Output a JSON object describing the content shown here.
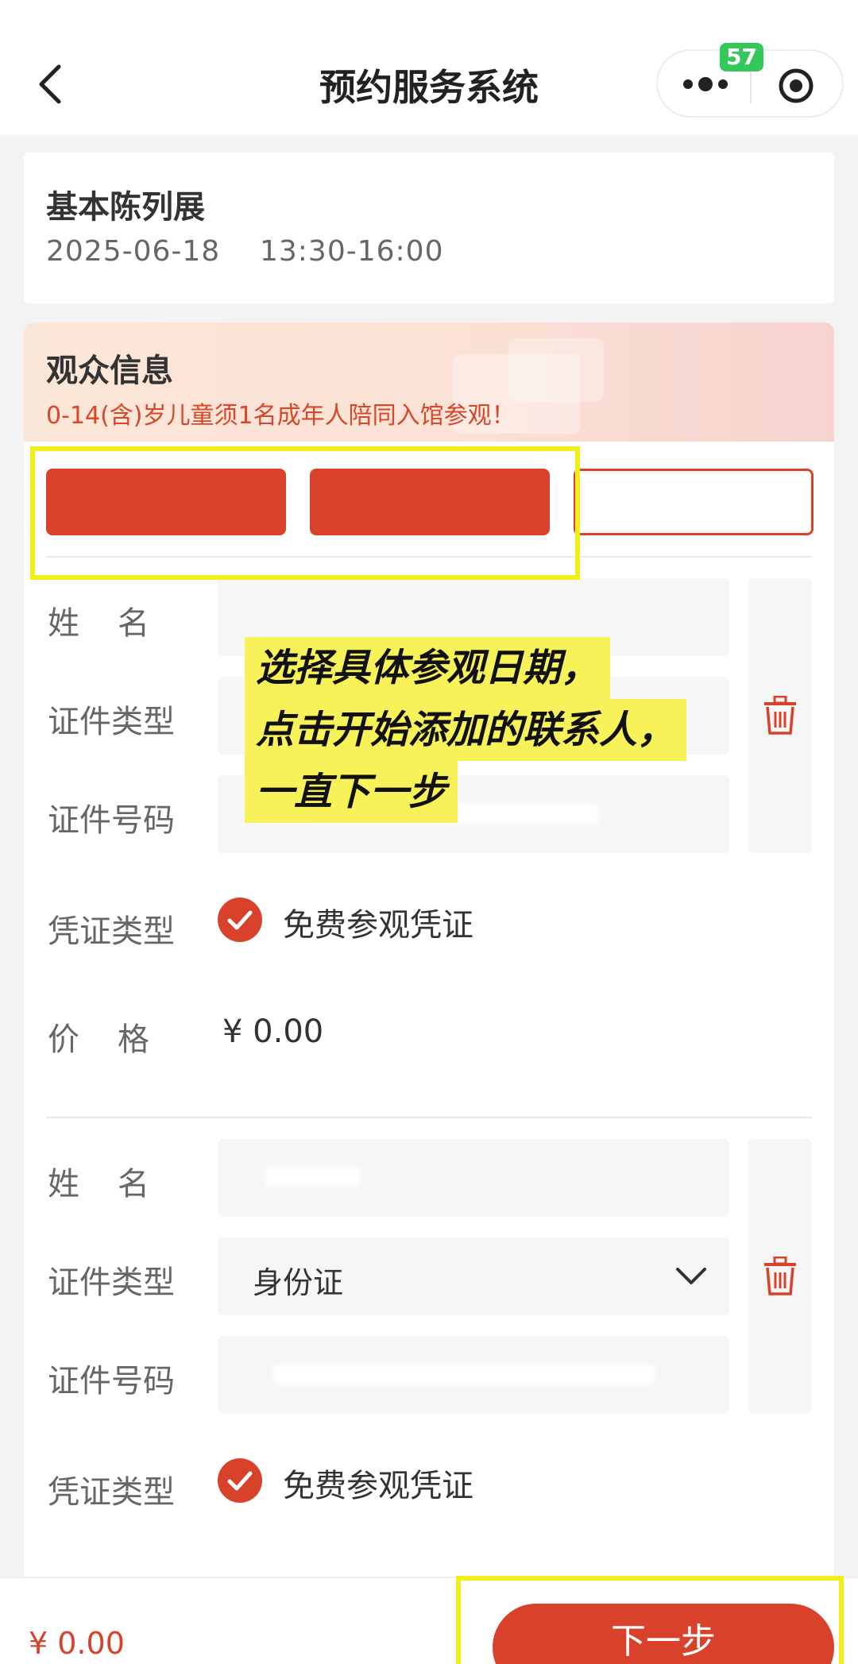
{
  "navbar": {
    "title": "预约服务系统",
    "badge_count": "57"
  },
  "exhibit": {
    "title": "基本陈列展",
    "datetime": "2025-06-18    13:30-16:00"
  },
  "visitor_section": {
    "title": "观众信息",
    "notice": "0-14(含)岁儿童须1名成年人陪同入馆参观！"
  },
  "contacts": [
    {
      "selected": true
    },
    {
      "selected": true
    },
    {
      "selected": false
    }
  ],
  "labels": {
    "name": "姓名",
    "id_type": "证件类型",
    "id_number": "证件号码",
    "voucher_type": "凭证类型",
    "price": "价格"
  },
  "visitors": [
    {
      "id_type_value": "",
      "voucher": "免费参观凭证",
      "price": "¥ 0.00"
    },
    {
      "id_type_value": "身份证",
      "voucher": "免费参观凭证"
    }
  ],
  "overlay_caption": {
    "line1": "选择具体参观日期，",
    "line2": "点击开始添加的联系人，",
    "line3": "一直下一步"
  },
  "footer": {
    "total": "¥ 0.00",
    "next_label": "下一步"
  },
  "colors": {
    "accent": "#d9422a",
    "highlight": "#f2ee1c",
    "badge": "#34c759"
  }
}
